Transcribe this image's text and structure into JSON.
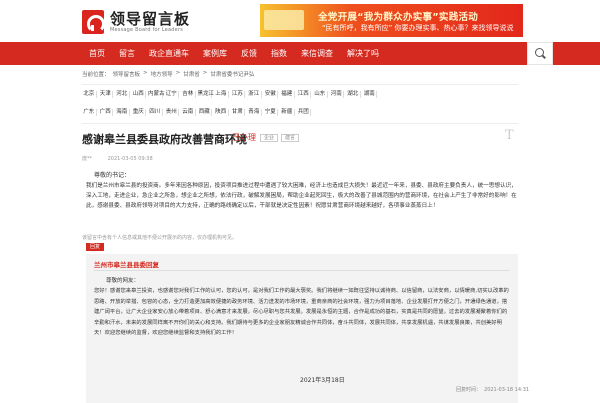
{
  "logo": {
    "cn": "领导留言板",
    "en": "Message Board for Leaders"
  },
  "banner": {
    "line1": "全党开展“我为群众办实事”实践活动",
    "line2": "“民有所呼，我有所应” 你要办理实事、热心事？来找领导说说"
  },
  "nav": {
    "items": [
      {
        "label": "首页"
      },
      {
        "label": "留言"
      },
      {
        "label": "政企直通车"
      },
      {
        "label": "案例库"
      },
      {
        "label": "反馈"
      },
      {
        "label": "指数"
      },
      {
        "label": "来信调查"
      },
      {
        "label": "解决了吗"
      }
    ]
  },
  "breadcrumb": [
    "当前位置：",
    "领导留言板",
    ">",
    "地方领导",
    ">",
    "甘肃省",
    ">",
    "甘肃省委书记尹弘"
  ],
  "provinces": {
    "row1": [
      "北京",
      "天津",
      "河北",
      "山西",
      "内蒙古",
      "辽宁",
      "吉林",
      "黑龙江",
      "上海",
      "江苏",
      "浙江",
      "安徽",
      "福建",
      "江西",
      "山东",
      "河南",
      "湖北",
      "湖南"
    ],
    "row2": [
      "广东",
      "广西",
      "海南",
      "重庆",
      "四川",
      "贵州",
      "云南",
      "西藏",
      "陕西",
      "甘肃",
      "青海",
      "宁夏",
      "新疆",
      "兵团"
    ]
  },
  "message": {
    "title": "感谢皋兰县委县政府改善营商环境",
    "status": "已办理",
    "tags": [
      "企业",
      "建言"
    ],
    "font_icon": "T",
    "author": "庞**",
    "date": "2021-03-05 09:38",
    "greeting": "尊敬的书记：",
    "body": "我们是兰州市皋兰县的投资商。多年来因各种原因，投资项目推进过程中遭遇了较大困难，经济上也造成巨大损失！最近近一年来，县委、县政府主要负责人，统一思想认识，深入工地，走进企业，急企业之所急，想企业之所想，依法行政，破解发展困局，帮助企业起死回生，极大的改善了县城范围内的营商环境，在社会上产生了非常好的影响！在此，感谢县委、县政府领导对项目的大力支持，正确的路线确定以后，干部就是决定性因素！祝愿甘肃营商环境越来越好，各项事业蒸蒸日上！"
  },
  "notice": "该留言中含有个人信息或其他不便公开展示的内容，仅办理机构可见。",
  "reply": {
    "label": "回复",
    "org": "兰州市皋兰县县委回复",
    "greeting": "尊敬的网友：",
    "body": "您好！感谢您来皋兰投资，也感谢您对我们工作的认可，您的认可，是对我们工作的最大褒奖。我们将继续一如既往坚持以诚待商、以信留商，以法安商，以情暖商,切实以改革的思路、开放的举措、包容的心态，全力打造更加高效便捷的政务环境、活力迸发的市场环境，重商亲商的社会环境，强力为项目落地、企业发展打开方便之门，开通绿色通道，搭建广阔平台，让广大企业家安心放心带着项目、舒心满意才来发展，尽心尽职与您共发展。发展是永恒的主题，合作是成功的基石，实真是共同的愿望。过去的发展凝聚着你们的辛勤和汗水，未来的发展同样离不开你们的关心和支持。我们期待与更多的企业家朋友精诚合作共同体，奋斗共同体，发展共同体，共享发展机遇，共谋发展良策，共创美好明天！欢迎您继续的监督，欢迎您继续监督和支持我们的工作！",
    "closing": "感谢您支持的留言，欢迎您继续监督和支持我们的工作！",
    "date": "2021年3月18日",
    "time_label": "回复时间：",
    "time": "2021-03-18 14:31"
  }
}
